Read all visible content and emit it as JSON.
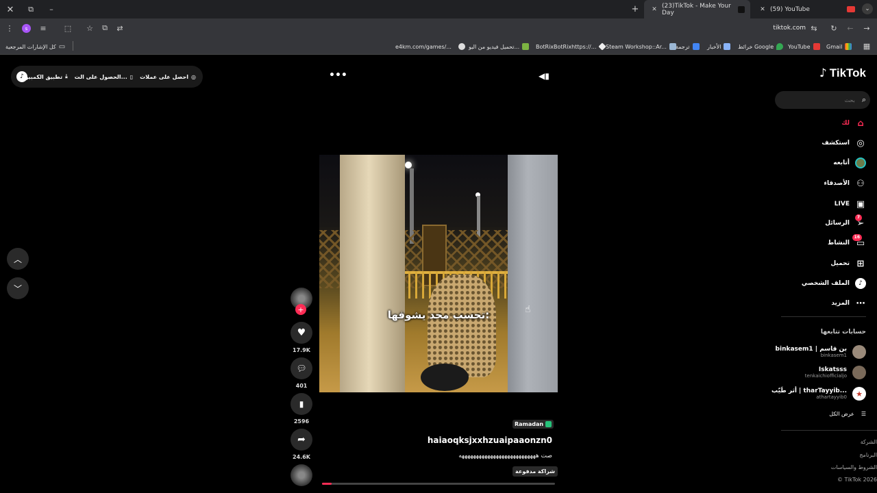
{
  "browser": {
    "tabs": [
      {
        "label": "(23)TikTok - Make Your Day",
        "active": true
      },
      {
        "label": "(59) YouTube",
        "active": false
      }
    ],
    "address": "tiktok.com",
    "bookmarks": [
      {
        "label": "كل الإشارات المرجعية"
      },
      {
        "label": "e4km.com/games/..."
      },
      {
        "label": "تحميل فيديو من اليو..."
      },
      {
        "label": "BotRixBotRixhttps://..."
      },
      {
        "label": "Steam Workshop::Ar..."
      },
      {
        "label": "ترجمة"
      },
      {
        "label": "الأخبار"
      },
      {
        "label": "خرائط Google"
      },
      {
        "label": "YouTube"
      },
      {
        "label": "Gmail"
      }
    ]
  },
  "topbar": {
    "get_coins": "احصل على عملات",
    "get_app": "الحصول على الت...",
    "desktop_app": "تطبيق الكمبيوتر"
  },
  "video": {
    "overlay_text": "تحسب محد يشوفها:",
    "tag_badge": "Ramadan",
    "username": "haiaoqksjxxhzuaipaaonzn0",
    "caption": "صت هههههههههههههههههههههههههههه",
    "paid_label": "شراكة مدفوعة",
    "progress": 0.04
  },
  "actions": {
    "likes": "17.9K",
    "comments": "401",
    "saves": "2596",
    "shares": "24.6K"
  },
  "sidebar": {
    "brand": "TikTok",
    "search_placeholder": "بحث",
    "items": [
      {
        "label": "لك",
        "icon": "home-icon"
      },
      {
        "label": "استكشف",
        "icon": "compass-icon"
      },
      {
        "label": "أتابعه",
        "icon": "following-avatar"
      },
      {
        "label": "الأصدقاء",
        "icon": "friends-icon"
      },
      {
        "label": "LIVE",
        "icon": "live-icon"
      },
      {
        "label": "الرسائل",
        "icon": "messages-icon",
        "badge": "7"
      },
      {
        "label": "النشاط",
        "icon": "activity-icon",
        "badge": "16"
      },
      {
        "label": "تحميل",
        "icon": "upload-icon"
      },
      {
        "label": "الملف الشخصي",
        "icon": "profile-icon"
      },
      {
        "label": "المزيد",
        "icon": "more-icon"
      }
    ],
    "following_title": "حسابات تتابعها",
    "accounts": [
      {
        "name": "binkasem1 | بن قاسم",
        "handle": "binkasem1"
      },
      {
        "name": "Iskatsss",
        "handle": "tenkaichiofficialjo"
      },
      {
        "name": "أثر طَيّب | tharTayyib...",
        "handle": "athartayyib0"
      }
    ],
    "see_all": "عرض الكل",
    "footer": [
      "الشركة",
      "البرنامج",
      "الشروط والسياسات",
      "© TikTok 2026"
    ]
  },
  "colors": {
    "accent": "#fe2c55",
    "bg": "#000000",
    "chrome": "#35363a"
  }
}
